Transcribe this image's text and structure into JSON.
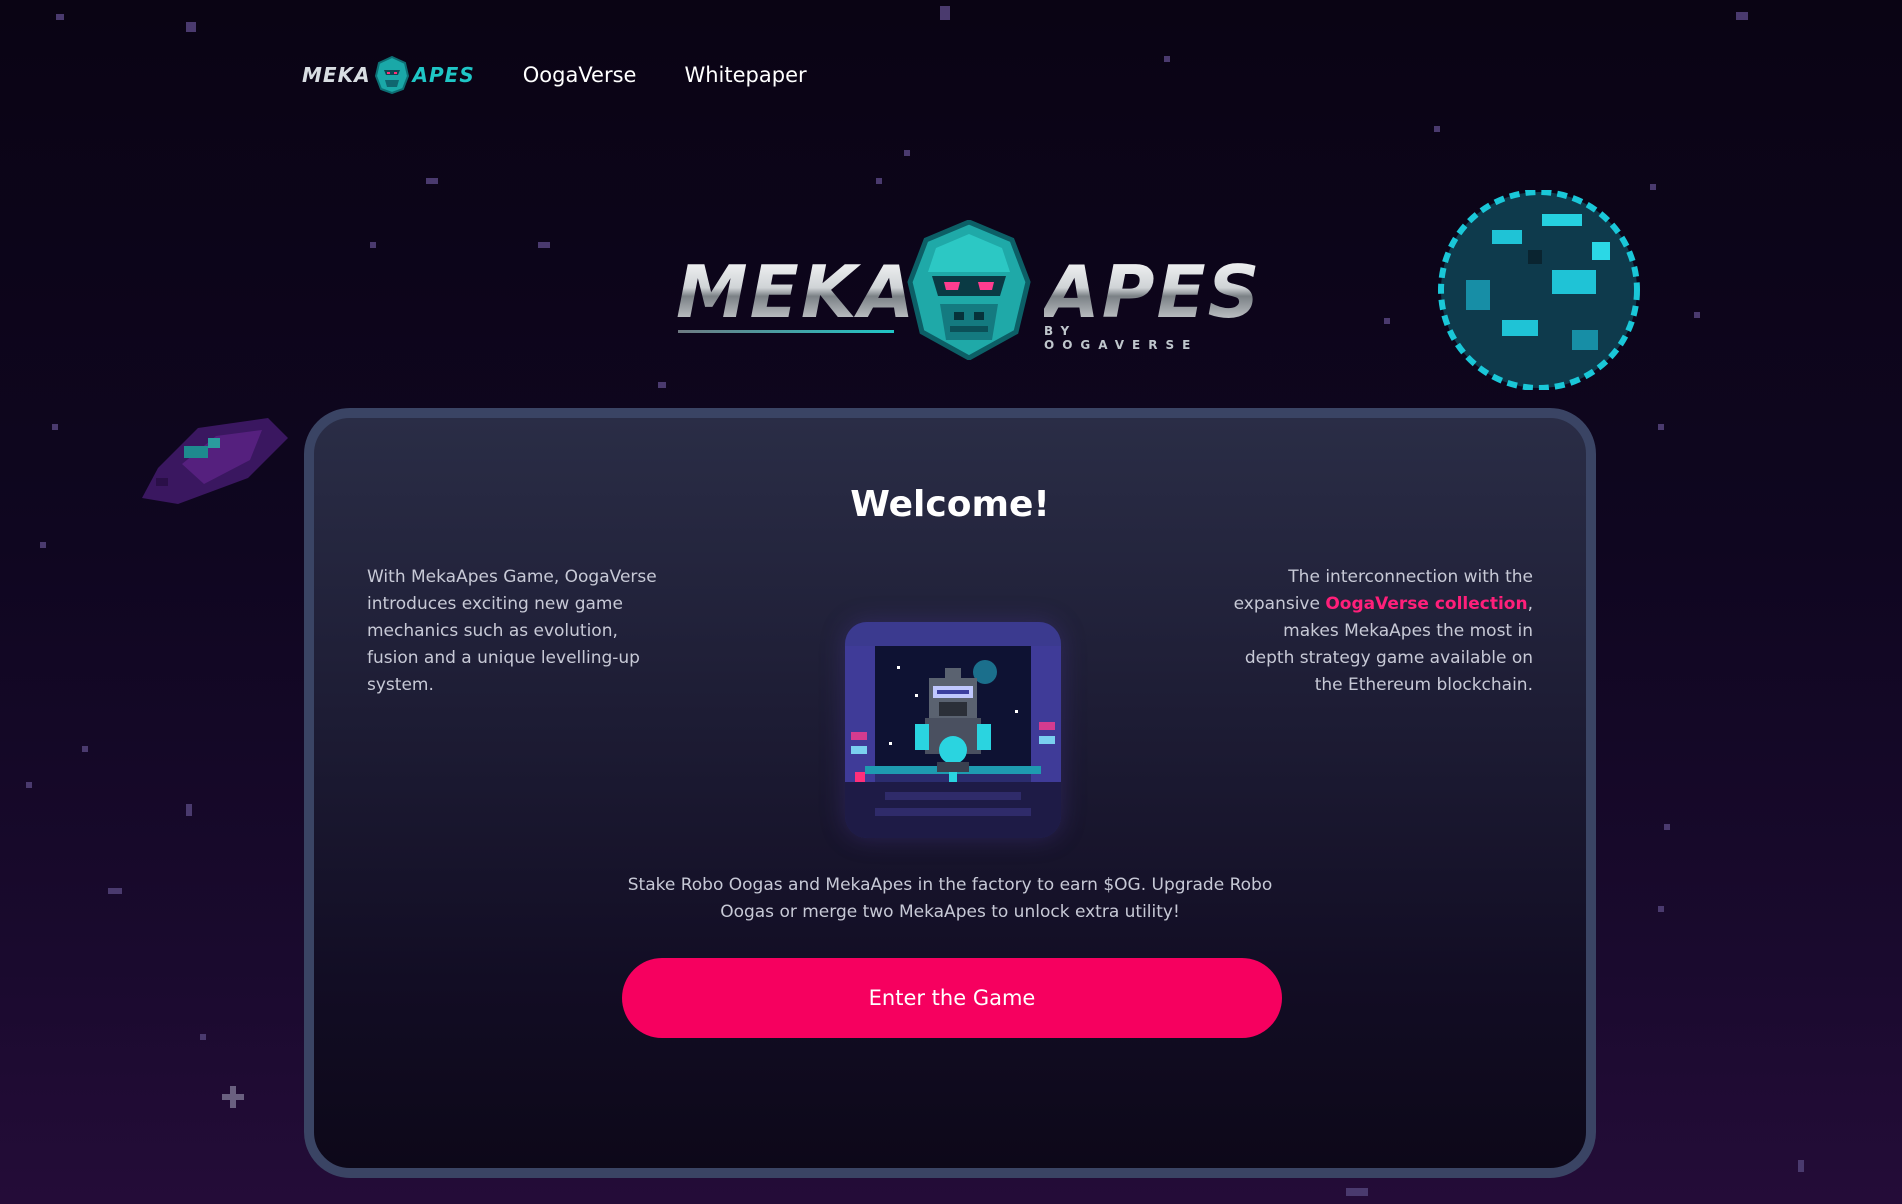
{
  "nav": {
    "logo_meka": "MEKA",
    "logo_apes": "APES",
    "links": [
      "OogaVerse",
      "Whitepaper"
    ]
  },
  "hero": {
    "word_left": "MEKA",
    "word_right": "APES",
    "subtitle": "BY OOGAVERSE"
  },
  "card": {
    "title": "Welcome!",
    "left_text": "With MekaApes Game, OogaVerse introduces exciting new game mechanics such as evolution, fusion and a unique levelling-up system.",
    "right_text_before": "The interconnection with the expansive ",
    "right_text_link": "OogaVerse collection",
    "right_text_after": ", makes MekaApes the most in depth strategy game available on the Ethereum blockchain.",
    "bottom_line1": "Stake Robo Oogas and MekaApes in the factory to earn $OG. Upgrade Robo",
    "bottom_line2": "Oogas or merge two MekaApes to unlock extra utility!",
    "button_label": "Enter the Game"
  },
  "icons": {
    "nav_logo": "ape-head-icon",
    "hero_logo": "ape-head-icon",
    "card_image": "robo-ooga-icon",
    "planet": "planet-icon",
    "asteroid": "asteroid-icon"
  },
  "colors": {
    "accent": "#f6005f",
    "link_highlight": "#ff1f7a",
    "teal": "#1fc6c6",
    "card_border": "#3a4464",
    "background_top": "#0a0414",
    "background_bottom": "#240c38"
  }
}
